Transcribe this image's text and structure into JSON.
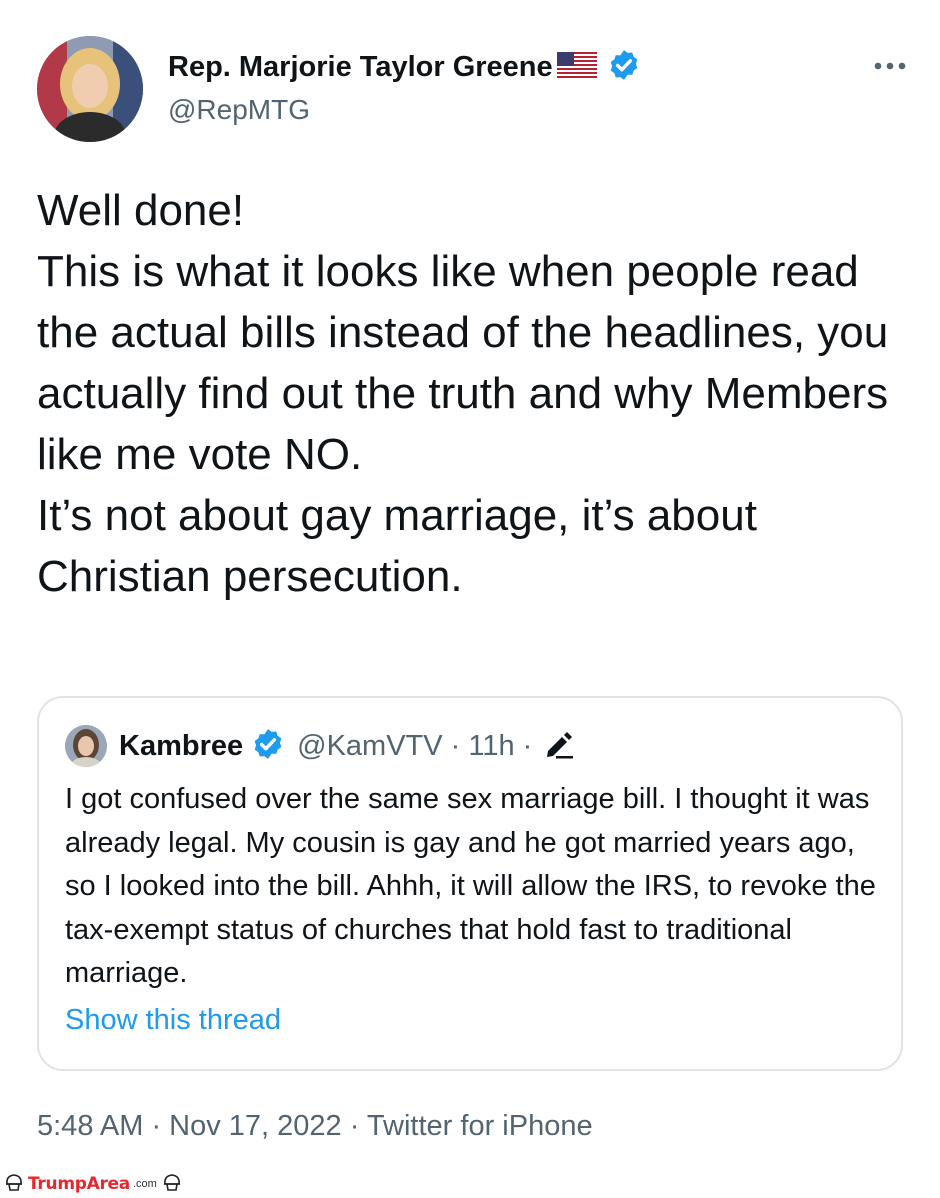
{
  "author": {
    "display_name": "Rep. Marjorie Taylor Greene",
    "handle": "@RepMTG",
    "verified": true,
    "flag_icon": "us-flag-icon"
  },
  "tweet": {
    "text": "Well done!\nThis is what it looks like when people read the actual bills instead of the headlines, you actually find out the truth and why Members like me vote NO.\nIt’s not about gay marriage, it’s about Christian persecution."
  },
  "quoted_tweet": {
    "display_name": "Kambree",
    "handle_time": "@KamVTV · 11h ·",
    "verified": true,
    "text": "I got confused over the same sex marriage bill. I thought it was already legal. My cousin is gay and he got married years ago, so I looked into the bill. Ahhh, it will allow the IRS, to revoke the tax-exempt status of churches that hold fast to traditional marriage.",
    "show_thread_label": "Show this thread"
  },
  "meta": {
    "text": "5:48 AM · Nov 17, 2022 · Twitter for iPhone"
  },
  "watermark": {
    "brand": "TrumpArea",
    "suffix": ".com"
  },
  "colors": {
    "link": "#1d9bf0",
    "secondary_text": "#536471",
    "verified_badge": "#1d9bf0",
    "watermark": "#e8272d"
  }
}
